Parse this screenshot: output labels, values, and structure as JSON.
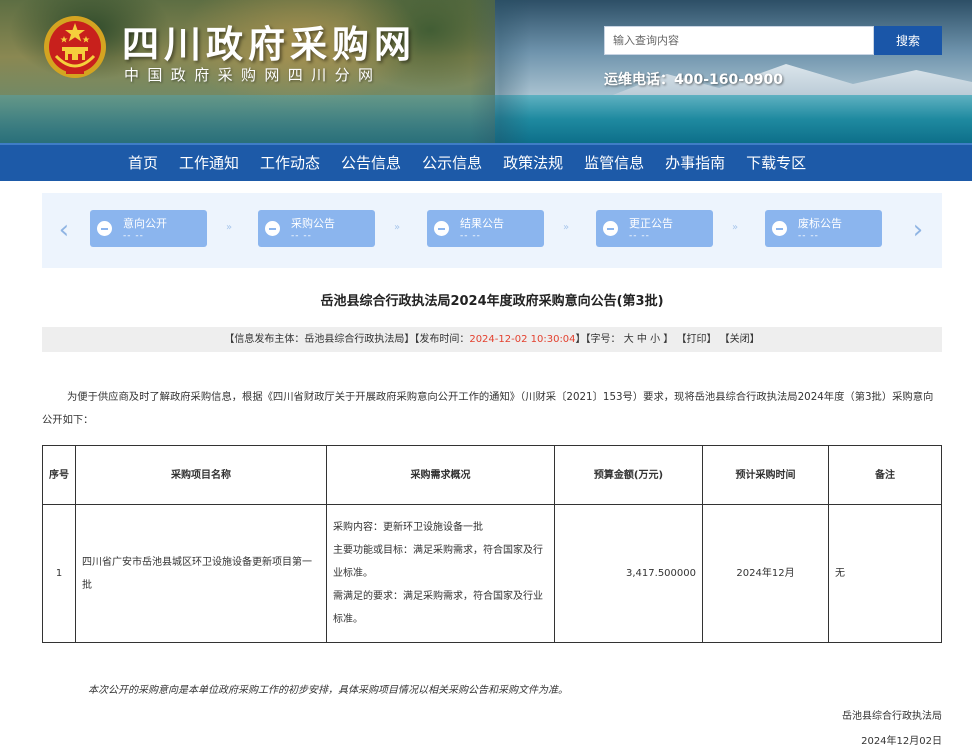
{
  "header": {
    "site_title": "四川政府采购网",
    "site_subtitle": "中国政府采购网四川分网",
    "search_placeholder": "输入查询内容",
    "search_button": "搜索",
    "hotline": "运维电话：400-160-0900"
  },
  "nav": {
    "items": [
      "首页",
      "工作通知",
      "工作动态",
      "公告信息",
      "公示信息",
      "政策法规",
      "监管信息",
      "办事指南",
      "下载专区"
    ]
  },
  "steps": {
    "items": [
      {
        "label": "意向公开",
        "sub": "-- --"
      },
      {
        "label": "采购公告",
        "sub": "-- --"
      },
      {
        "label": "结果公告",
        "sub": "-- --"
      },
      {
        "label": "更正公告",
        "sub": "-- --"
      },
      {
        "label": "废标公告",
        "sub": "-- --"
      }
    ],
    "separator": "»"
  },
  "article": {
    "title": "岳池县综合行政执法局2024年度政府采购意向公告(第3批)",
    "meta": {
      "publisher_prefix": "【信息发布主体：岳池县综合行政执法局】【发布时间：",
      "publish_time": "2024-12-02 10:30:04",
      "font_prefix": "】【字号：",
      "font_large": "大",
      "font_medium": "中",
      "font_small": "小",
      "font_suffix": "】",
      "print": "【打印】",
      "close": "【关闭】"
    },
    "intro": "为便于供应商及时了解政府采购信息，根据《四川省财政厅关于开展政府采购意向公开工作的通知》（川财采〔2021〕153号）要求，现将岳池县综合行政执法局2024年度（第3批）采购意向公开如下：",
    "table": {
      "headers": [
        "序号",
        "采购项目名称",
        "采购需求概况",
        "预算金额(万元)",
        "预计采购时间",
        "备注"
      ],
      "rows": [
        {
          "no": "1",
          "name": "四川省广安市岳池县城区环卫设施设备更新项目第一批",
          "req_1": "采购内容：更新环卫设施设备一批",
          "req_2": "主要功能或目标：满足采购需求，符合国家及行业标准。",
          "req_3": "需满足的要求：满足采购需求，符合国家及行业标准。",
          "budget": "3,417.500000",
          "time": "2024年12月",
          "note": "无"
        }
      ]
    },
    "footnote": "本次公开的采购意向是本单位政府采购工作的初步安排，具体采购项目情况以相关采购公告和采购文件为准。",
    "signature": "岳池县综合行政执法局",
    "date": "2024年12月02日"
  },
  "colors": {
    "nav_bg": "#1d5aa8",
    "search_button_bg": "#1a56a8",
    "step_bg": "#8bb5ee",
    "steps_panel_bg": "#edf4fd",
    "publish_time_color": "#e3412f"
  }
}
